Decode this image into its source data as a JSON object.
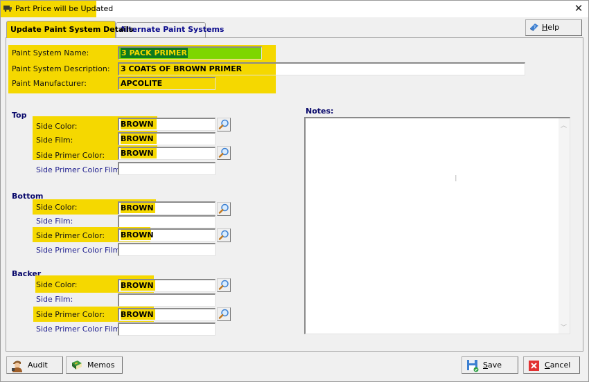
{
  "window": {
    "title": "Part Price will be Updated",
    "close_glyph": "✕",
    "title_icon": "truck-icon"
  },
  "tabs": [
    {
      "label": "Update Paint System Details",
      "active": true
    },
    {
      "label": "Alternate Paint Systems",
      "active": false
    }
  ],
  "help_button": {
    "label_prefix": "H",
    "label_rest": "elp",
    "icon": "help-book-icon"
  },
  "header_fields": {
    "name": {
      "label": "Paint System Name:",
      "value": "3 PACK PRIMER"
    },
    "description": {
      "label": "Paint System Description:",
      "value": "3 COATS OF BROWN PRIMER"
    },
    "manufacturer": {
      "label": "Paint Manufacturer:",
      "value": "APCOLITE"
    }
  },
  "sections": {
    "top": {
      "title": "Top",
      "side_color": {
        "label": "Side Color:",
        "value": "BROWN"
      },
      "side_film": {
        "label": "Side Film:",
        "value": "BROWN"
      },
      "side_primer_color": {
        "label": "Side Primer Color:",
        "value": "BROWN"
      },
      "side_primer_color_film": {
        "label": "Side Primer Color Film:",
        "value": ""
      }
    },
    "bottom": {
      "title": "Bottom",
      "side_color": {
        "label": "Side Color:",
        "value": "BROWN"
      },
      "side_film": {
        "label": "Side Film:",
        "value": ""
      },
      "side_primer_color": {
        "label": "Side Primer Color:",
        "value": "BROWN"
      },
      "side_primer_color_film": {
        "label": "Side Primer Color Film:",
        "value": ""
      }
    },
    "backer": {
      "title": "Backer",
      "side_color": {
        "label": "Side Color:",
        "value": "BROWN"
      },
      "side_film": {
        "label": "Side Film:",
        "value": ""
      },
      "side_primer_color": {
        "label": "Side Primer Color:",
        "value": "BROWN"
      },
      "side_primer_color_film": {
        "label": "Side Primer Color Film:",
        "value": ""
      }
    }
  },
  "notes": {
    "label": "Notes:",
    "value": ""
  },
  "buttons": {
    "audit": "Audit",
    "memos": "Memos",
    "save_prefix": "S",
    "save_rest": "ave",
    "cancel_prefix": "C",
    "cancel_rest": "ancel"
  },
  "colors": {
    "highlight": "#f5d800",
    "name_field_bg": "#7ed600",
    "selection": "#0b7a1e",
    "label_blue": "#1a1a8c"
  }
}
